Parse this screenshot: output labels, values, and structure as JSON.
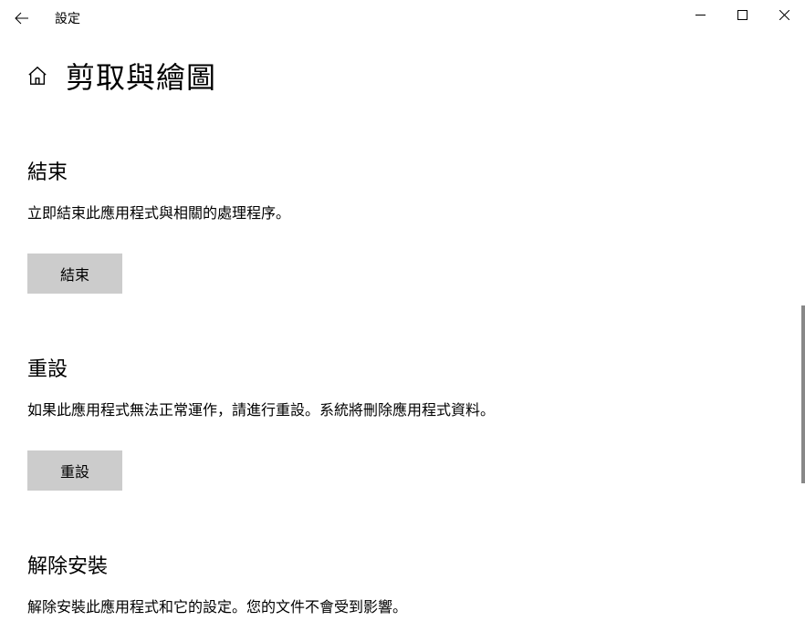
{
  "titlebar": {
    "title": "設定"
  },
  "page": {
    "title": "剪取與繪圖"
  },
  "sections": {
    "terminate": {
      "title": "結束",
      "description": "立即結束此應用程式與相關的處理程序。",
      "button": "結束"
    },
    "reset": {
      "title": "重設",
      "description": "如果此應用程式無法正常運作，請進行重設。系統將刪除應用程式資料。",
      "button": "重設"
    },
    "uninstall": {
      "title": "解除安裝",
      "description": "解除安裝此應用程式和它的設定。您的文件不會受到影響。"
    }
  }
}
